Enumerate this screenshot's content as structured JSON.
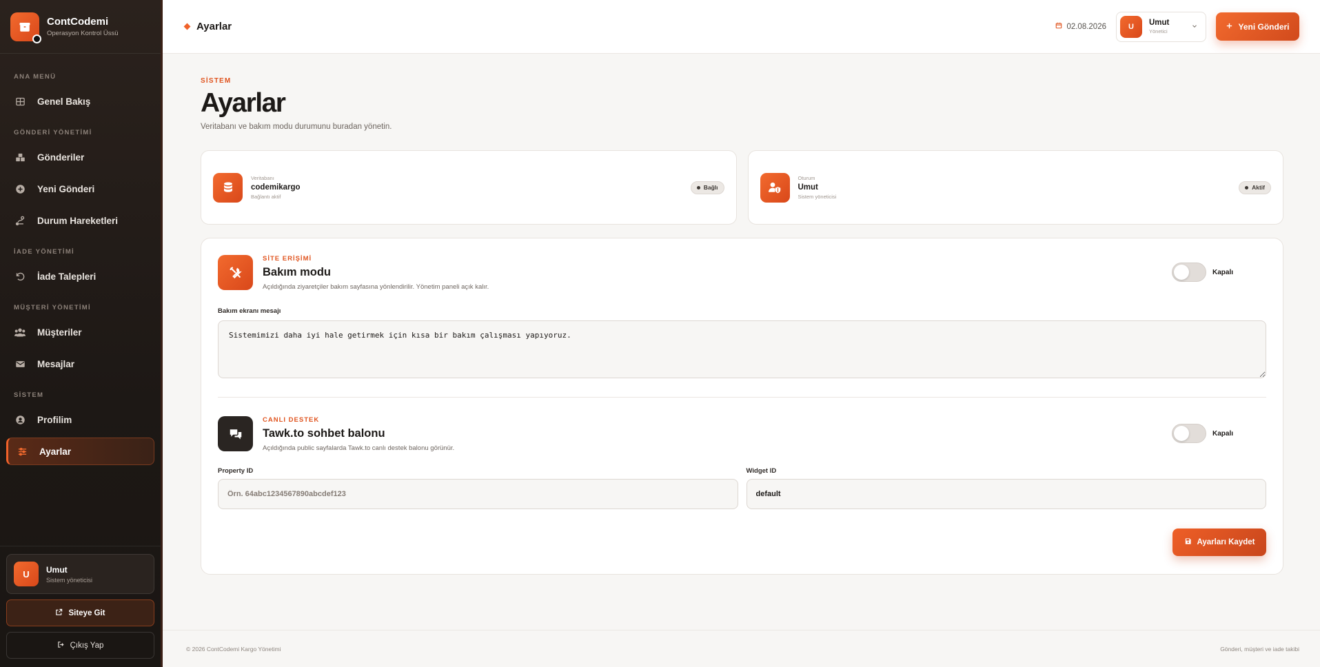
{
  "brand": {
    "name": "ContCodemi",
    "subtitle": "Operasyon Kontrol Üssü"
  },
  "sidebar": {
    "sections": [
      {
        "label": "ANA MENÜ"
      },
      {
        "label": "GÖNDERİ YÖNETİMİ"
      },
      {
        "label": "İADE YÖNETİMİ"
      },
      {
        "label": "MÜŞTERİ YÖNETİMİ"
      },
      {
        "label": "SİSTEM"
      }
    ],
    "items": [
      {
        "label": "Genel Bakış",
        "icon": "grid-icon"
      },
      {
        "label": "Gönderiler",
        "icon": "boxes-icon"
      },
      {
        "label": "Yeni Gönderi",
        "icon": "plus-circle-icon"
      },
      {
        "label": "Durum Hareketleri",
        "icon": "route-icon"
      },
      {
        "label": "İade Talepleri",
        "icon": "undo-icon"
      },
      {
        "label": "Müşteriler",
        "icon": "users-icon"
      },
      {
        "label": "Mesajlar",
        "icon": "mail-icon"
      },
      {
        "label": "Profilim",
        "icon": "user-circle-icon"
      },
      {
        "label": "Ayarlar",
        "icon": "sliders-icon",
        "active": true
      }
    ],
    "user": {
      "initial": "U",
      "name": "Umut",
      "role": "Sistem yöneticisi"
    },
    "site_button": "Siteye Git",
    "logout_button": "Çıkış Yap"
  },
  "topbar": {
    "title": "Ayarlar",
    "date": "02.08.2026",
    "user": {
      "initial": "U",
      "name": "Umut",
      "role": "Yönetici"
    },
    "new_button": "Yeni Gönderi"
  },
  "page": {
    "eyebrow": "SİSTEM",
    "title": "Ayarlar",
    "description": "Veritabanı ve bakım modu durumunu buradan yönetin."
  },
  "info_cards": [
    {
      "label": "Veritabanı",
      "value": "codemikargo",
      "sub": "Bağlantı aktif",
      "badge": "Bağlı",
      "icon": "database-icon"
    },
    {
      "label": "Oturum",
      "value": "Umut",
      "sub": "Sistem yöneticisi",
      "badge": "Aktif",
      "icon": "user-shield-icon"
    }
  ],
  "maintenance": {
    "eyebrow": "SİTE ERİŞİMİ",
    "title": "Bakım modu",
    "description": "Açıldığında ziyaretçiler bakım sayfasına yönlendirilir. Yönetim paneli açık kalır.",
    "toggle_label": "Kapalı",
    "enabled": false,
    "message_label": "Bakım ekranı mesajı",
    "message_value": "Sistemimizi daha iyi hale getirmek için kısa bir bakım çalışması yapıyoruz."
  },
  "livechat": {
    "eyebrow": "CANLI DESTEK",
    "title": "Tawk.to sohbet balonu",
    "description": "Açıldığında public sayfalarda Tawk.to canlı destek balonu görünür.",
    "toggle_label": "Kapalı",
    "enabled": false,
    "property_label": "Property ID",
    "property_placeholder": "Örn. 64abc1234567890abcdef123",
    "property_value": "",
    "widget_label": "Widget ID",
    "widget_value": "default"
  },
  "save_button": "Ayarları Kaydet",
  "footer": {
    "left": "© 2026 ContCodemi Kargo Yönetimi",
    "right": "Gönderi, müşteri ve iade takibi"
  },
  "colors": {
    "accent": "#f0622a",
    "sidebar_bg": "#1d1815",
    "page_bg": "#f7f6f4"
  }
}
